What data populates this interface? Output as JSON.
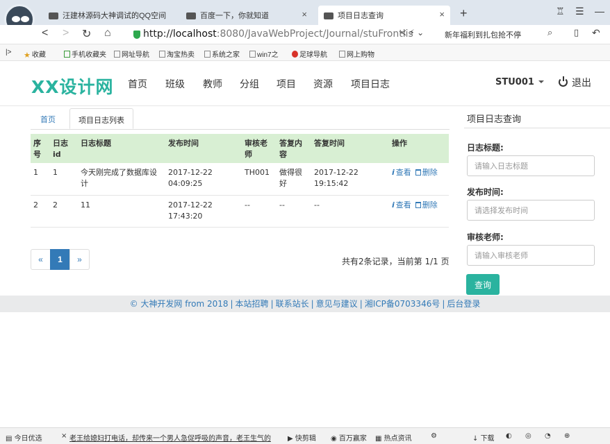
{
  "browser": {
    "tabs": [
      {
        "title": "汪建林源码大神调试的QQ空间"
      },
      {
        "title": "百度一下，你就知道"
      },
      {
        "title": "项目日志查询"
      }
    ],
    "address": {
      "scheme": "http://",
      "host": "localhost",
      "path": ":8080/JavaWebProject/Journal/stuFrontlis"
    },
    "news_text": "新年福利到扎包抢不停",
    "bookmarks": [
      "收藏",
      "手机收藏夹",
      "网址导航",
      "淘宝热卖",
      "系统之家",
      "win7之",
      "足球导航",
      "网上购物"
    ]
  },
  "site": {
    "brand": "XX设计网",
    "menu": [
      "首页",
      "班级",
      "教师",
      "分组",
      "项目",
      "资源",
      "项目日志"
    ],
    "user": "STU001",
    "logout": "退出"
  },
  "content_tabs": {
    "home": "首页",
    "active": "项目日志列表"
  },
  "table": {
    "headers": [
      "序号",
      "日志id",
      "日志标题",
      "发布时间",
      "审核老师",
      "答复内容",
      "答复时间",
      "操作"
    ],
    "rows": [
      {
        "seq": "1",
        "id": "1",
        "title": "今天刚完成了数据库设计",
        "publish_time": "2017-12-22 04:09:25",
        "teacher": "TH001",
        "reply": "做得很好",
        "reply_time": "2017-12-22 19:15:42",
        "view": "查看",
        "delete": "删除"
      },
      {
        "seq": "2",
        "id": "2",
        "title": "11",
        "publish_time": "2017-12-22 17:43:20",
        "teacher": "--",
        "reply": "--",
        "reply_time": "--",
        "view": "查看",
        "delete": "删除"
      }
    ]
  },
  "pagination": {
    "prev": "«",
    "current": "1",
    "next": "»",
    "info": "共有2条记录，当前第 1/1 页"
  },
  "query": {
    "title": "项目日志查询",
    "fields": [
      {
        "label": "日志标题:",
        "placeholder": "请输入日志标题"
      },
      {
        "label": "发布时间:",
        "placeholder": "请选择发布时间"
      },
      {
        "label": "审核老师:",
        "placeholder": "请输入审核老师"
      }
    ],
    "submit": "查询"
  },
  "footer": {
    "links": [
      "© 大神开发网 from 2018",
      "本站招聘",
      "联系站长",
      "意见与建议",
      "湘ICP备0703346号",
      "后台登录"
    ]
  },
  "statusbar": {
    "left": "今日优选",
    "ticker": "老王给媳妇打电话，却传来一个男人急促呼吸的声音，老王生气的",
    "items": [
      "快剪辑",
      "百万赢家",
      "热点资讯",
      "下载"
    ]
  }
}
